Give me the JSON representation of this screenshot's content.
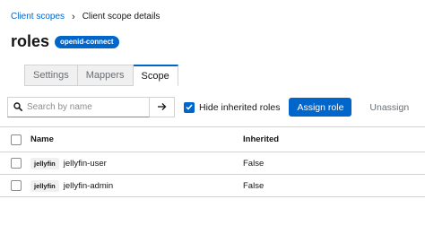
{
  "breadcrumb": {
    "parent": "Client scopes",
    "separator": "›",
    "current": "Client scope details"
  },
  "page": {
    "title": "roles",
    "badge": "openid-connect"
  },
  "tabs": [
    {
      "label": "Settings",
      "active": false
    },
    {
      "label": "Mappers",
      "active": false
    },
    {
      "label": "Scope",
      "active": true
    }
  ],
  "toolbar": {
    "search_placeholder": "Search by name",
    "search_value": "",
    "hide_inherited_label": "Hide inherited roles",
    "hide_inherited_checked": true,
    "assign_role_label": "Assign role",
    "unassign_label": "Unassign"
  },
  "table": {
    "headers": {
      "name": "Name",
      "inherited": "Inherited"
    },
    "rows": [
      {
        "client": "jellyfin",
        "role": "jellyfin-user",
        "inherited": "False"
      },
      {
        "client": "jellyfin",
        "role": "jellyfin-admin",
        "inherited": "False"
      }
    ]
  },
  "colors": {
    "accent": "#0066cc",
    "border": "#d2d2d2"
  },
  "icons": {
    "search": "search-icon",
    "arrow": "arrow-right-icon",
    "check": "check-icon"
  }
}
